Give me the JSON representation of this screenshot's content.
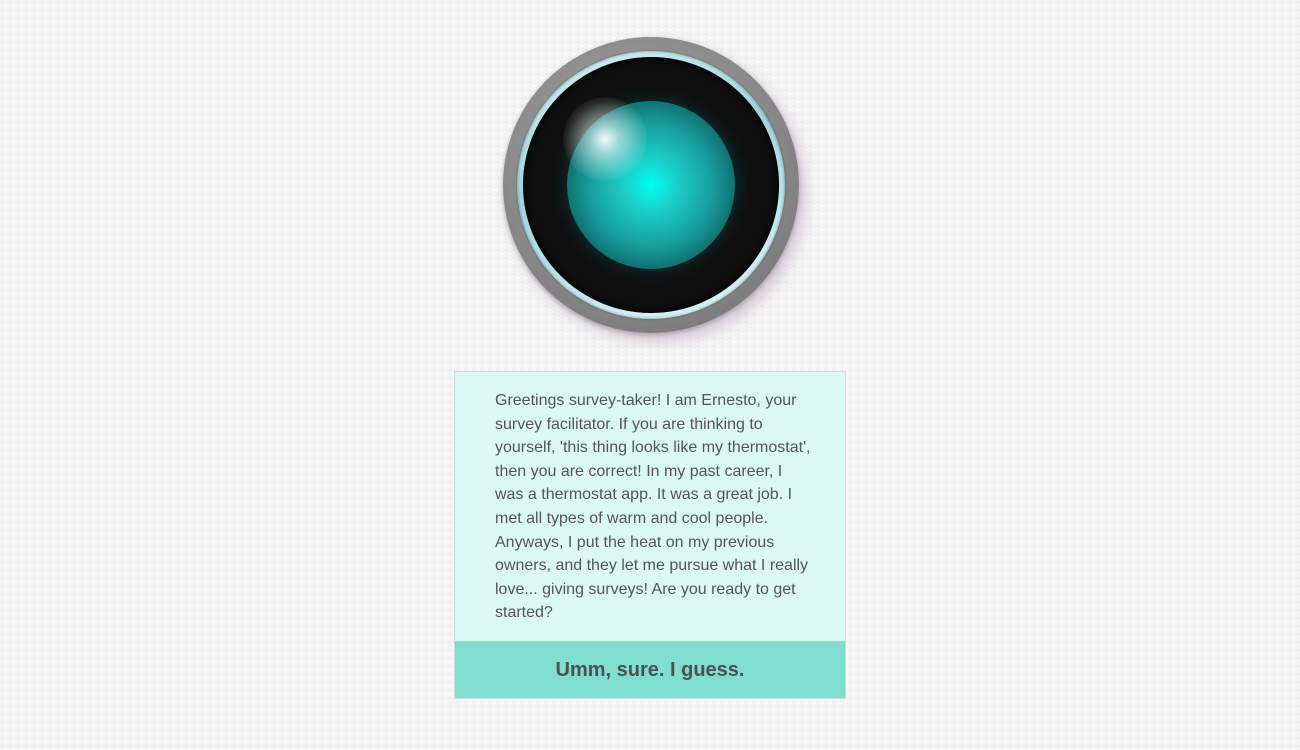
{
  "robot": {
    "icon": "robot-eye-icon",
    "colors": {
      "iris": "#00fff2",
      "socket": "#0f0f0f",
      "ring": "#9fd5df"
    }
  },
  "message": {
    "text": "Greetings survey-taker! I am Ernesto, your survey facilitator. If you are thinking to yourself, 'this thing looks like my thermostat', then you are correct! In my past career, I was a thermostat app. It was a great job. I met all types of warm and cool people. Anyways, I put the heat on my previous owners, and they let me pursue what I really love... giving surveys! Are you ready to get started?",
    "reply_label": "Umm, sure. I guess.",
    "colors": {
      "card_background": "#dcf8f3",
      "button_background": "#80ded1"
    }
  }
}
